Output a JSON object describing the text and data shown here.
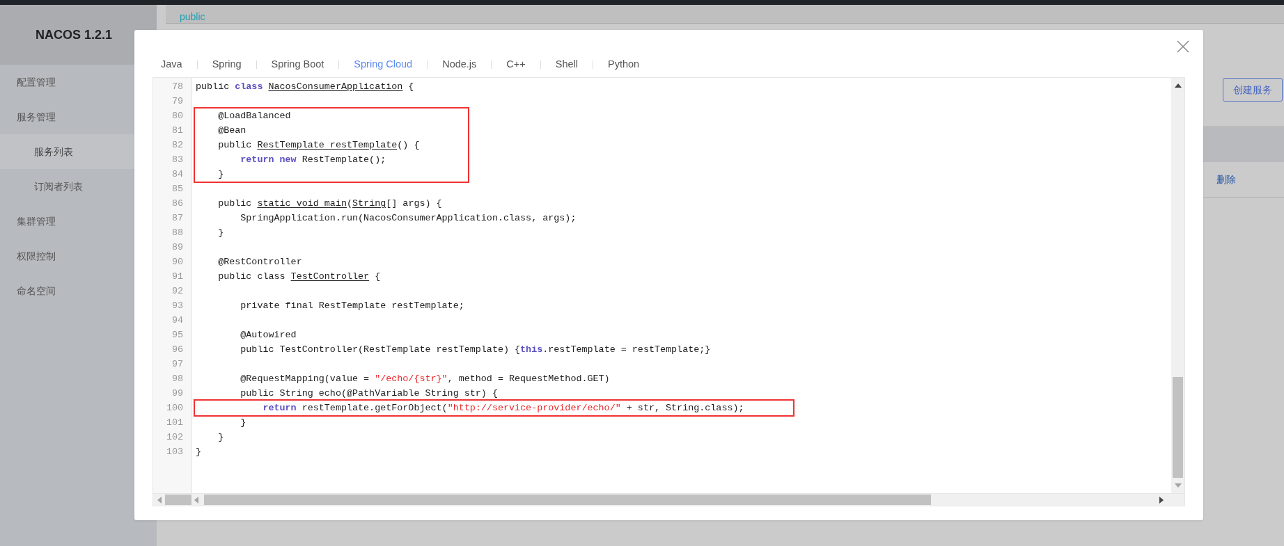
{
  "app": {
    "title": "NACOS 1.2.1"
  },
  "sidebar": {
    "items": [
      {
        "label": "配置管理",
        "selected": false
      },
      {
        "label": "服务管理",
        "selected": false,
        "children": [
          {
            "label": "服务列表",
            "selected": true
          },
          {
            "label": "订阅者列表",
            "selected": false
          }
        ]
      },
      {
        "label": "集群管理",
        "selected": false
      },
      {
        "label": "权限控制",
        "selected": false
      },
      {
        "label": "命名空间",
        "selected": false
      }
    ]
  },
  "background": {
    "namespace": "public",
    "create_button": "创建服务",
    "row_action": "删除"
  },
  "modal": {
    "tabs": [
      {
        "label": "Java",
        "selected": false
      },
      {
        "label": "Spring",
        "selected": false
      },
      {
        "label": "Spring Boot",
        "selected": false
      },
      {
        "label": "Spring Cloud",
        "selected": true
      },
      {
        "label": "Node.js",
        "selected": false
      },
      {
        "label": "C++",
        "selected": false
      },
      {
        "label": "Shell",
        "selected": false
      },
      {
        "label": "Python",
        "selected": false
      }
    ],
    "code_blocks": [
      {
        "boxed": false,
        "lines": [
          {
            "number": "78",
            "tokens": [
              {
                "kind": "text",
                "text": "public "
              },
              {
                "kind": "keyword",
                "text": "class "
              },
              {
                "kind": "underlined",
                "text": "NacosConsumerApplication"
              },
              {
                "kind": "text",
                "text": " {"
              }
            ]
          },
          {
            "number": "79"
          }
        ]
      },
      {
        "boxed": true,
        "lines": [
          {
            "number": "80",
            "tokens": [
              {
                "kind": "text",
                "text": "    @LoadBalanced"
              }
            ]
          },
          {
            "number": "81",
            "tokens": [
              {
                "kind": "text",
                "text": "    @Bean"
              }
            ]
          },
          {
            "number": "82",
            "tokens": [
              {
                "kind": "text",
                "text": "    public "
              },
              {
                "kind": "underlined",
                "text": "RestTemplate restTemplate"
              },
              {
                "kind": "text",
                "text": "() {"
              }
            ]
          },
          {
            "number": "83",
            "tokens": [
              {
                "kind": "keyword",
                "text": "        return new"
              },
              {
                "kind": "text",
                "text": " RestTemplate();"
              }
            ]
          },
          {
            "number": "84",
            "tokens": [
              {
                "kind": "text",
                "text": "    }"
              }
            ]
          }
        ]
      },
      {
        "boxed": false,
        "lines": [
          {
            "number": "85"
          },
          {
            "number": "86",
            "tokens": [
              {
                "kind": "text",
                "text": "    public "
              },
              {
                "kind": "underlined",
                "text": "static void main"
              },
              {
                "kind": "text",
                "text": "("
              },
              {
                "kind": "underlined",
                "text": "String"
              },
              {
                "kind": "text",
                "text": "[] args) {"
              }
            ]
          },
          {
            "number": "87",
            "tokens": [
              {
                "kind": "text",
                "text": "        SpringApplication.run(NacosConsumerApplication.class, args);"
              }
            ]
          },
          {
            "number": "88",
            "tokens": [
              {
                "kind": "text",
                "text": "    }"
              }
            ]
          },
          {
            "number": "89"
          },
          {
            "number": "90",
            "tokens": [
              {
                "kind": "text",
                "text": "    @RestController"
              }
            ]
          },
          {
            "number": "91",
            "tokens": [
              {
                "kind": "text",
                "text": "    public class "
              },
              {
                "kind": "underlined",
                "text": "TestController"
              },
              {
                "kind": "text",
                "text": " {"
              }
            ]
          },
          {
            "number": "92"
          },
          {
            "number": "93",
            "tokens": [
              {
                "kind": "text",
                "text": "        private final RestTemplate restTemplate;"
              }
            ]
          },
          {
            "number": "94"
          },
          {
            "number": "95",
            "tokens": [
              {
                "kind": "text",
                "text": "        @Autowired"
              }
            ]
          },
          {
            "number": "96",
            "tokens": [
              {
                "kind": "text",
                "text": "        public TestController(RestTemplate restTemplate) {"
              },
              {
                "kind": "keyword",
                "text": "this"
              },
              {
                "kind": "text",
                "text": ".restTemplate = restTemplate;}"
              }
            ]
          },
          {
            "number": "97"
          },
          {
            "number": "98",
            "tokens": [
              {
                "kind": "text",
                "text": "        @RequestMapping(value = "
              },
              {
                "kind": "string",
                "text": "\"/echo/{str}\""
              },
              {
                "kind": "text",
                "text": ", method = RequestMethod.GET)"
              }
            ]
          },
          {
            "number": "99",
            "tokens": [
              {
                "kind": "text",
                "text": "        public String echo(@PathVariable String str) {"
              }
            ]
          }
        ]
      },
      {
        "boxed": true,
        "lines": [
          {
            "number": "100",
            "tokens": [
              {
                "kind": "keyword",
                "text": "            return"
              },
              {
                "kind": "text",
                "text": " restTemplate.getForObject("
              },
              {
                "kind": "string",
                "text": "\"http://service-provider/echo/\""
              },
              {
                "kind": "text",
                "text": " + str, String.class);"
              }
            ]
          }
        ]
      },
      {
        "boxed": false,
        "lines": [
          {
            "number": "101",
            "tokens": [
              {
                "kind": "text",
                "text": "        }"
              }
            ]
          },
          {
            "number": "102",
            "tokens": [
              {
                "kind": "text",
                "text": "    }"
              }
            ]
          },
          {
            "number": "103",
            "tokens": [
              {
                "kind": "text",
                "text": "}"
              }
            ]
          }
        ]
      }
    ]
  }
}
